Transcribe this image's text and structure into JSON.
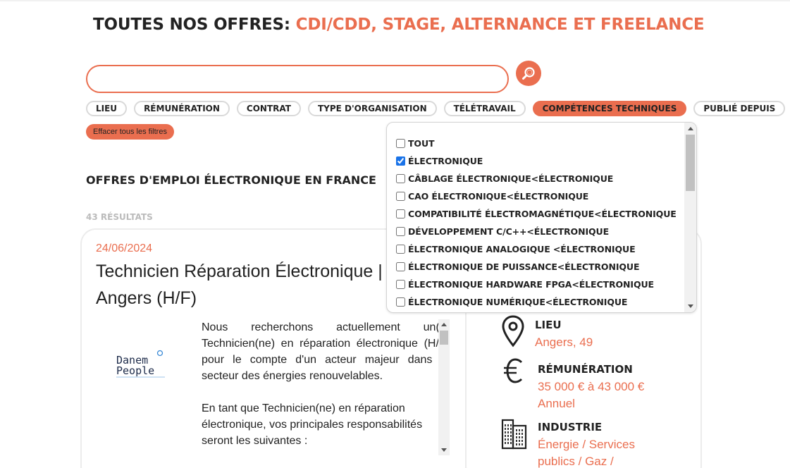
{
  "header": {
    "title_prefix": "TOUTES NOS OFFRES: ",
    "title_accent": "CDI/CDD, STAGE, ALTERNANCE ET FREELANCE"
  },
  "search": {
    "value": "",
    "placeholder": ""
  },
  "filters": [
    {
      "label": "LIEU",
      "active": false
    },
    {
      "label": "RÉMUNÉRATION",
      "active": false
    },
    {
      "label": "CONTRAT",
      "active": false
    },
    {
      "label": "TYPE D'ORGANISATION",
      "active": false
    },
    {
      "label": "TÉLÉTRAVAIL",
      "active": false
    },
    {
      "label": "COMPÉTENCES TECHNIQUES",
      "active": true
    },
    {
      "label": "PUBLIÉ DEPUIS",
      "active": false
    }
  ],
  "clear_filters_label": "Effacer tous les filtres",
  "results": {
    "heading": "OFFRES D'EMPLOI ÉLECTRONIQUE EN FRANCE",
    "count": "43 RÉSULTATS"
  },
  "job": {
    "date": "24/06/2024",
    "title": "Technicien Réparation Électronique | Angers (H/F)",
    "logo": {
      "line1": "Danem",
      "line2": "People"
    },
    "description": [
      "Nous recherchons actuellement un(e) Technicien(ne) en réparation électronique (H/F) pour le compte d'un acteur majeur dans le secteur des énergies renouvelables.",
      "En tant que Technicien(ne) en réparation électronique, vos principales responsabilités seront les suivantes :"
    ],
    "info": {
      "location_label": "LIEU",
      "location_value": "Angers, 49",
      "salary_label": "RÉMUNÉRATION",
      "salary_value": "35 000 € à 43 000 €",
      "salary_period": "Annuel",
      "industry_label": "INDUSTRIE",
      "industry_value": "Énergie / Services publics / Gaz /"
    }
  },
  "dropdown": {
    "options": [
      {
        "label": "TOUT",
        "checked": false
      },
      {
        "label": "ÉLECTRONIQUE",
        "checked": true
      },
      {
        "label": "CÂBLAGE ÉLECTRONIQUE<ÉLECTRONIQUE",
        "checked": false
      },
      {
        "label": "CAO ÉLECTRONIQUE<ÉLECTRONIQUE",
        "checked": false
      },
      {
        "label": "COMPATIBILITÉ ÉLECTROMAGNÉTIQUE<ÉLECTRONIQUE",
        "checked": false
      },
      {
        "label": "DÉVELOPPEMENT C/C++<ÉLECTRONIQUE",
        "checked": false
      },
      {
        "label": "ÉLECTRONIQUE ANALOGIQUE <ÉLECTRONIQUE",
        "checked": false
      },
      {
        "label": "ÉLECTRONIQUE DE PUISSANCE<ÉLECTRONIQUE",
        "checked": false
      },
      {
        "label": "ÉLECTRONIQUE HARDWARE FPGA<ÉLECTRONIQUE",
        "checked": false
      },
      {
        "label": "ÉLECTRONIQUE NUMÉRIQUE<ÉLECTRONIQUE",
        "checked": false
      }
    ]
  },
  "colors": {
    "accent": "#ea6e4f",
    "text": "#222222",
    "muted": "#bbbbbb",
    "chip_border": "#d9d9d9"
  },
  "icons": {
    "search": "magnifier-icon",
    "location": "map-pin-icon",
    "salary": "euro-icon",
    "industry": "buildings-icon"
  }
}
